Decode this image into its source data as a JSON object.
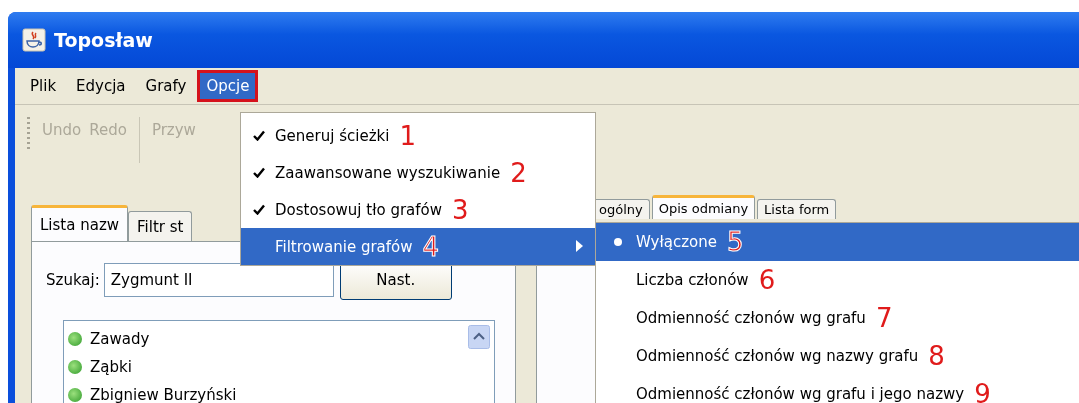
{
  "window": {
    "title": "Toposław"
  },
  "menu_bar": [
    {
      "label": "Plik",
      "selected": false,
      "outlined": false
    },
    {
      "label": "Edycja",
      "selected": false,
      "outlined": false
    },
    {
      "label": "Grafy",
      "selected": false,
      "outlined": false
    },
    {
      "label": "Opcje",
      "selected": true,
      "outlined": true
    }
  ],
  "toolbar": [
    {
      "label": "Undo",
      "disabled": true
    },
    {
      "label": "Redo",
      "disabled": true
    },
    {
      "label": "Przyw",
      "disabled": true
    }
  ],
  "left_tabs": [
    {
      "label": "Lista nazw",
      "selected": true
    },
    {
      "label": "Filtr st",
      "selected": false
    }
  ],
  "search": {
    "label": "Szukaj:",
    "value": "Zygmunt II",
    "button": "Nast."
  },
  "names": [
    "Zawady",
    "Ząbki",
    "Zbigniew Burzyński"
  ],
  "right_tabs": [
    {
      "label": "ogólny",
      "selected": false
    },
    {
      "label": "Opis odmiany",
      "selected": true
    },
    {
      "label": "Lista form",
      "selected": false
    }
  ],
  "menu": [
    {
      "kind": "check",
      "label": "Generuj ścieżki",
      "checked": true,
      "selected": false,
      "marker": "1"
    },
    {
      "kind": "check",
      "label": "Zaawansowane wyszukiwanie",
      "checked": true,
      "selected": false,
      "marker": "2"
    },
    {
      "kind": "check",
      "label": "Dostosowuj tło grafów",
      "checked": true,
      "selected": false,
      "marker": "3"
    },
    {
      "kind": "submenu",
      "label": "Filtrowanie grafów",
      "selected": true,
      "marker": "4"
    }
  ],
  "submenu": [
    {
      "label": "Wyłączone",
      "selected": true,
      "marker": "5"
    },
    {
      "label": "Liczba członów",
      "selected": false,
      "marker": "6"
    },
    {
      "label": "Odmienność członów wg grafu",
      "selected": false,
      "marker": "7"
    },
    {
      "label": "Odmienność członów wg nazwy grafu",
      "selected": false,
      "marker": "8"
    },
    {
      "label": "Odmienność członów wg grafu i jego nazwy",
      "selected": false,
      "marker": "9"
    }
  ]
}
